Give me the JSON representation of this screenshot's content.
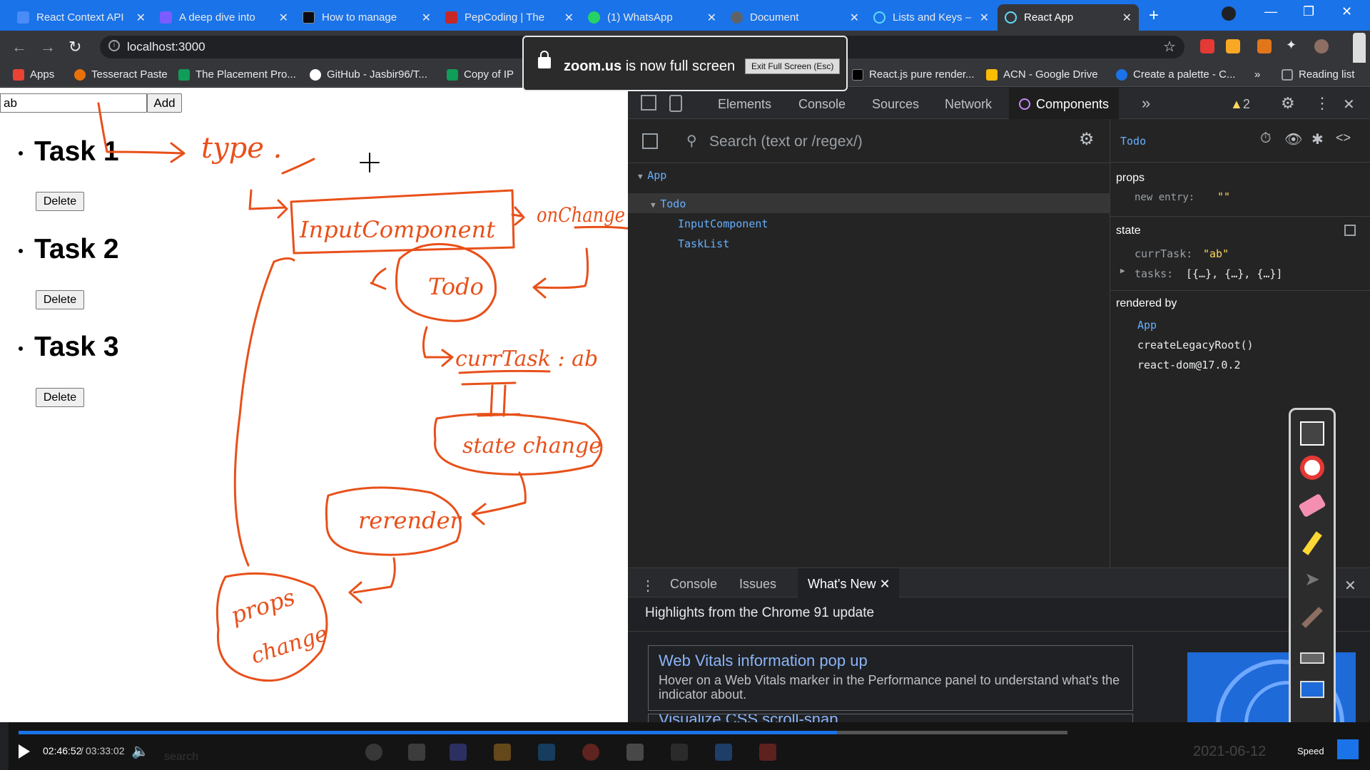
{
  "browser": {
    "tabs": [
      {
        "title": "React Context API",
        "color": "#4b8bf5"
      },
      {
        "title": "A deep dive into",
        "color": "#7b5cff"
      },
      {
        "title": "How to manage",
        "color": "#1d1d1f"
      },
      {
        "title": "PepCoding | The",
        "color": "#c62828"
      },
      {
        "title": "(1) WhatsApp",
        "color": "#25d366"
      },
      {
        "title": "Document",
        "color": "#5f6368"
      },
      {
        "title": "Lists and Keys – R",
        "color": "#61dafb"
      },
      {
        "title": "React App",
        "color": "#61dafb"
      }
    ],
    "url": "localhost:3000",
    "bookmarks": [
      {
        "label": "Apps",
        "color": "#ea4335"
      },
      {
        "label": "Tesseract Paste",
        "color": "#e8710a"
      },
      {
        "label": "The Placement Pro...",
        "color": "#0f9d58"
      },
      {
        "label": "GitHub - Jasbir96/T...",
        "color": "#ffffff"
      },
      {
        "label": "Copy of IP",
        "color": "#0f9d58"
      },
      {
        "label": "React.js pure render...",
        "color": "#000000"
      },
      {
        "label": "ACN - Google Drive",
        "color": "#fbbc04"
      },
      {
        "label": "Create a palette - C...",
        "color": "#1a73e8"
      },
      {
        "label": "Reading list",
        "color": "#9aa0a6"
      }
    ]
  },
  "zoom_notice": {
    "app": "zoom.us",
    "message": "is now full screen",
    "exit_label": "Exit Full Screen (Esc)"
  },
  "app": {
    "input_value": "ab",
    "add_label": "Add",
    "tasks": [
      {
        "label": "Task 1",
        "delete": "Delete"
      },
      {
        "label": "Task 2",
        "delete": "Delete"
      },
      {
        "label": "Task 3",
        "delete": "Delete"
      }
    ]
  },
  "annotations": {
    "type": "type .",
    "input_component": "InputComponent",
    "on_change": "onChange",
    "todo": "Todo",
    "curr_task": "currTask : ab",
    "state_change": "state change",
    "rerender": "rerender",
    "props_change_1": "props",
    "props_change_2": "change"
  },
  "devtools": {
    "tabs": [
      "Elements",
      "Console",
      "Sources",
      "Network",
      "Components"
    ],
    "active_tab": "Components",
    "warnings": "2",
    "search_placeholder": "Search (text or /regex/)",
    "tree": [
      {
        "name": "App",
        "level": 0
      },
      {
        "name": "Todo",
        "level": 1
      },
      {
        "name": "InputComponent",
        "level": 2
      },
      {
        "name": "TaskList",
        "level": 2
      }
    ],
    "selected": "Todo",
    "props_heading": "props",
    "props_key": "new entry",
    "props_value": "\"\"",
    "state_heading": "state",
    "state_currtask_key": "currTask",
    "state_currtask_value": "\"ab\"",
    "state_tasks_key": "tasks",
    "state_tasks_value": "[{…}, {…}, {…}]",
    "rendered_by_heading": "rendered by",
    "rendered_by": [
      "App",
      "createLegacyRoot()",
      "react-dom@17.0.2"
    ]
  },
  "drawer": {
    "tabs": [
      "Console",
      "Issues",
      "What's New"
    ],
    "active": "What's New",
    "highlight_title": "Highlights from the Chrome 91 update",
    "card_title": "Web Vitals information pop up",
    "card_desc": "Hover on a Web Vitals marker in the Performance panel to understand what's the indicator about.",
    "next_card_title": "Visualize CSS scroll-snap"
  },
  "player": {
    "current": "02:46:52",
    "separator": "/",
    "total": "03:33:02",
    "speed_label": "Speed",
    "progress": 0.78,
    "background_search": "search",
    "background_clock": "2021-06-12"
  }
}
